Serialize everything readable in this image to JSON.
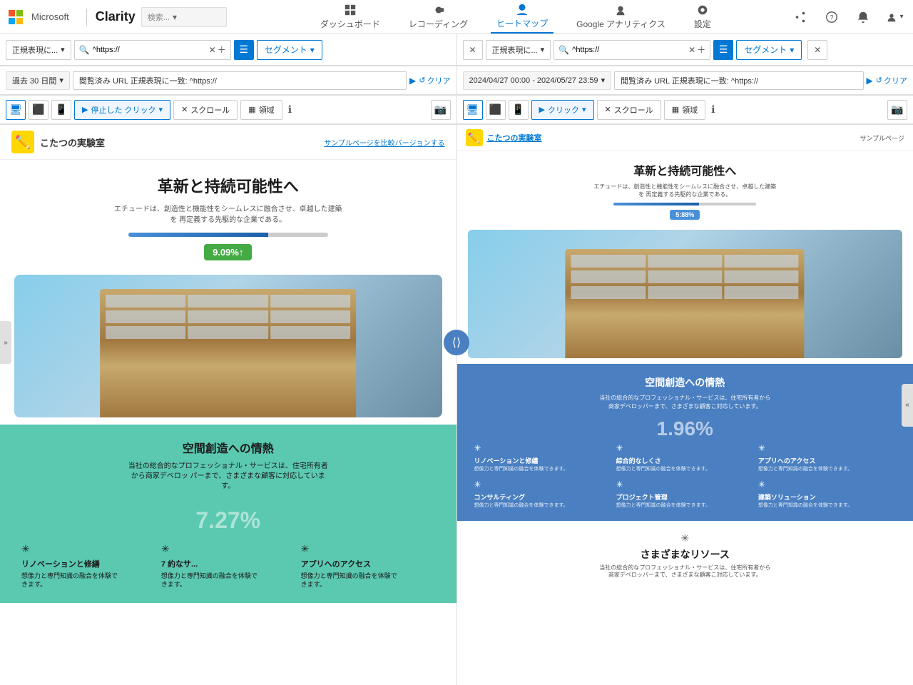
{
  "app": {
    "brand": "Clarity",
    "msLogo": "Microsoft"
  },
  "nav": {
    "dashboard": "ダッシュボード",
    "recording": "レコーディング",
    "heatmap": "ヒートマップ",
    "analytics": "Google アナリティクス",
    "settings": "設定"
  },
  "leftPanel": {
    "filterBar": {
      "regexLabel": "正規表現に...",
      "searchValue": "^https://",
      "segmentLabel": "セグメント"
    },
    "filterBar2": {
      "dateLabel": "過去 30 日間",
      "urlFilter": "閲覧済み URL 正規表現に一致: ^https://",
      "clearLabel": "クリア"
    },
    "viewBar": {
      "clickMode": "停止した クリック",
      "scroll": "スクロール",
      "area": "領域"
    },
    "site": {
      "logoEmoji": "✏️",
      "name": "こたつの実験室",
      "link": "サンプルページを比較バージョンする",
      "heroTitle": "革新と持続可能性へ",
      "heroDesc": "エチュードは、創造性と機能性をシームレスに融合させ、卓越した建築を\n再定義する先駆的な企業である。",
      "heroBadge": "9.09%↑",
      "section2Title": "空間創造への情熱",
      "section2Desc": "当社の総合的なプロフェッショナル・サービスは、住宅所有者から商家デベロッ\nパーまで、さまざまな顧客に対応しています。",
      "heatBadge": "7.27%",
      "grid": [
        {
          "title": "リノベーションと修繕",
          "desc": "想像力と専門知識の融合を体験で\nきます。"
        },
        {
          "title": "7 約なサ...",
          "desc": "想像力と専門知識の融合を体験で\nきます。"
        },
        {
          "title": "アプリへのアクセス",
          "desc": "想像力と専門知識の融合を体験で\nきます。"
        }
      ]
    }
  },
  "rightPanel": {
    "filterBar": {
      "dateLabel": "2024/04/27 00:00 - 2024/05/27 23:59",
      "urlFilter": "閲覧済み URL 正規表現に一致: ^https://",
      "clearLabel": "クリア",
      "segmentLabel": "セグメント"
    },
    "viewBar": {
      "clickMode": "クリック",
      "scroll": "スクロール",
      "area": "領域"
    },
    "site": {
      "logoEmoji": "✏️",
      "name": "こたつの実験室",
      "link": "サンプルページ",
      "heroTitle": "革新と持続可能性へ",
      "heroDesc": "エチュードは、創造性と機能性をシームレスに融合させ、卓越した建築を\n再定義する先駆的な企業である。",
      "heroBadge": "5:88%",
      "section2Title": "空間創造への情熱",
      "section2Desc": "当社の総合的なプロフェッショナル・サービスは、住宅所有者から商家デベロッパーまで、さまざまな顧客こ対応しています。",
      "heatPct": "1.96%",
      "grid1": [
        {
          "title": "リノベーションと修繕",
          "desc": "想像力と専門知識の融合を体験できます。"
        },
        {
          "title": "綜合的なしくさ",
          "desc": "想像力と専門知識の融合を体験できます。"
        },
        {
          "title": "アプリへのアクセス",
          "desc": "想像力と専門知識の融合を体験できます。"
        }
      ],
      "grid2": [
        {
          "title": "コンサルティング",
          "desc": "想像力と専門知識の融合を体験できます。"
        },
        {
          "title": "プロジェクト管理",
          "desc": "想像力と専門知識の融合を体験できます。"
        },
        {
          "title": "建築ソリューション",
          "desc": "想像力と専門知識の融合を体験できます。"
        }
      ],
      "section3Title": "さまざまなリソース",
      "section3Desc": "当社の総合的なプロフェッショナル・サービスは、住宅所有者から商家デベロッパーまで、さまざまな顧客こ対応しています。"
    }
  },
  "compareBtnLabel": "⟨⟩"
}
